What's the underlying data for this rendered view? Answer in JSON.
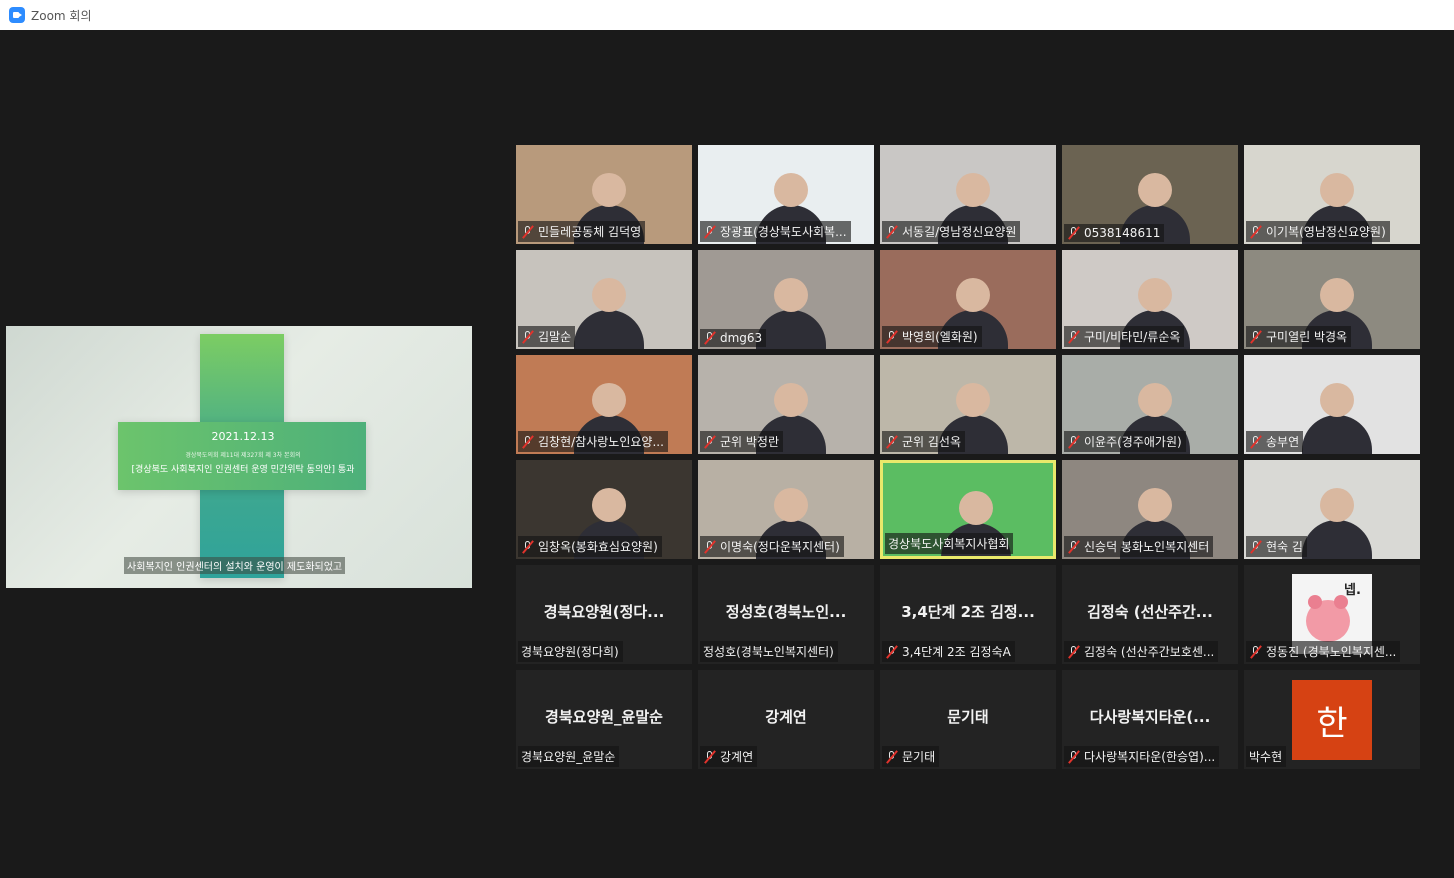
{
  "window": {
    "title": "Zoom 회의"
  },
  "share": {
    "date": "2021.12.13",
    "subtitle": "경상북도의회 제11대 제327회 제 3차 본회의",
    "headline": "[경상북도 사회복지인 인권센터 운영 민간위탁 동의안] 통과",
    "caption": "사회복지인 인권센터의 설치와 운영이 제도화되었고"
  },
  "participants": [
    {
      "label": "민들레공동체 김덕영",
      "muted": true,
      "video": true,
      "bg": "#b89a7c"
    },
    {
      "label": "장광표(경상북도사회복...",
      "muted": true,
      "video": true,
      "bg": "#e9eef0"
    },
    {
      "label": "서동길/영남정신요양원",
      "muted": true,
      "video": true,
      "bg": "#c9c7c5"
    },
    {
      "label": "0538148611",
      "muted": true,
      "video": true,
      "bg": "#6b6352"
    },
    {
      "label": "이기복(영남정신요양원)",
      "muted": true,
      "video": true,
      "bg": "#d7d6ce"
    },
    {
      "label": "김말순",
      "muted": true,
      "video": true,
      "bg": "#c7c3bd"
    },
    {
      "label": "dmg63",
      "muted": true,
      "video": true,
      "bg": "#a09a94"
    },
    {
      "label": "박영희(엘화원)",
      "muted": true,
      "video": true,
      "bg": "#9a6c5c"
    },
    {
      "label": "구미/비타민/류순옥",
      "muted": true,
      "video": true,
      "bg": "#cfcac6"
    },
    {
      "label": "구미열린 박경옥",
      "muted": true,
      "video": true,
      "bg": "#8d8a80"
    },
    {
      "label": "김창현/참사랑노인요양...",
      "muted": true,
      "video": true,
      "bg": "#c07b55"
    },
    {
      "label": "군위 박정란",
      "muted": true,
      "video": true,
      "bg": "#b7b2ab"
    },
    {
      "label": "군위 김선옥",
      "muted": true,
      "video": true,
      "bg": "#bdb7a9"
    },
    {
      "label": "이윤주(경주애가원)",
      "muted": true,
      "video": true,
      "bg": "#a9ada8"
    },
    {
      "label": "송부연",
      "muted": true,
      "video": true,
      "bg": "#e2e2e2"
    },
    {
      "label": "임창옥(봉화효심요양원)",
      "muted": true,
      "video": true,
      "bg": "#3b3630"
    },
    {
      "label": "이명숙(정다운복지센터)",
      "muted": true,
      "video": true,
      "bg": "#b8b0a4"
    },
    {
      "label": "경상북도사회복지사협회",
      "muted": false,
      "video": true,
      "active": true,
      "bg": "#5bbd62"
    },
    {
      "label": "신승덕 봉화노인복지센터",
      "muted": true,
      "video": true,
      "bg": "#8e8780"
    },
    {
      "label": "현숙 김",
      "muted": true,
      "video": true,
      "bg": "#d9d9d5"
    },
    {
      "label": "경북요양원(정다희)",
      "center": "경북요양원(정다...",
      "muted": false,
      "video": false
    },
    {
      "label": "정성호(경북노인복지센터)",
      "center": "정성호(경북노인...",
      "muted": false,
      "video": false
    },
    {
      "label": "3,4단계 2조 김정숙A",
      "center": "3,4단계 2조 김정...",
      "muted": true,
      "video": false
    },
    {
      "label": "김정숙 (선산주간보호센...",
      "center": "김정숙 (선산주간...",
      "muted": true,
      "video": false
    },
    {
      "label": "정동진 (경북노인복지센...",
      "muted": true,
      "video": false,
      "avatar": "sticker",
      "sticker_text": "넵."
    },
    {
      "label": "경북요양원_윤말순",
      "center": "경북요양원_윤말순",
      "muted": false,
      "video": false
    },
    {
      "label": "강계연",
      "center": "강계연",
      "muted": true,
      "video": false
    },
    {
      "label": "문기태",
      "center": "문기태",
      "muted": true,
      "video": false
    },
    {
      "label": "다사랑복지타운(한승엽)...",
      "center": "다사랑복지타운(...",
      "muted": true,
      "video": false
    },
    {
      "label": "박수현",
      "muted": false,
      "video": false,
      "avatar": "initial",
      "initial": "한"
    }
  ]
}
